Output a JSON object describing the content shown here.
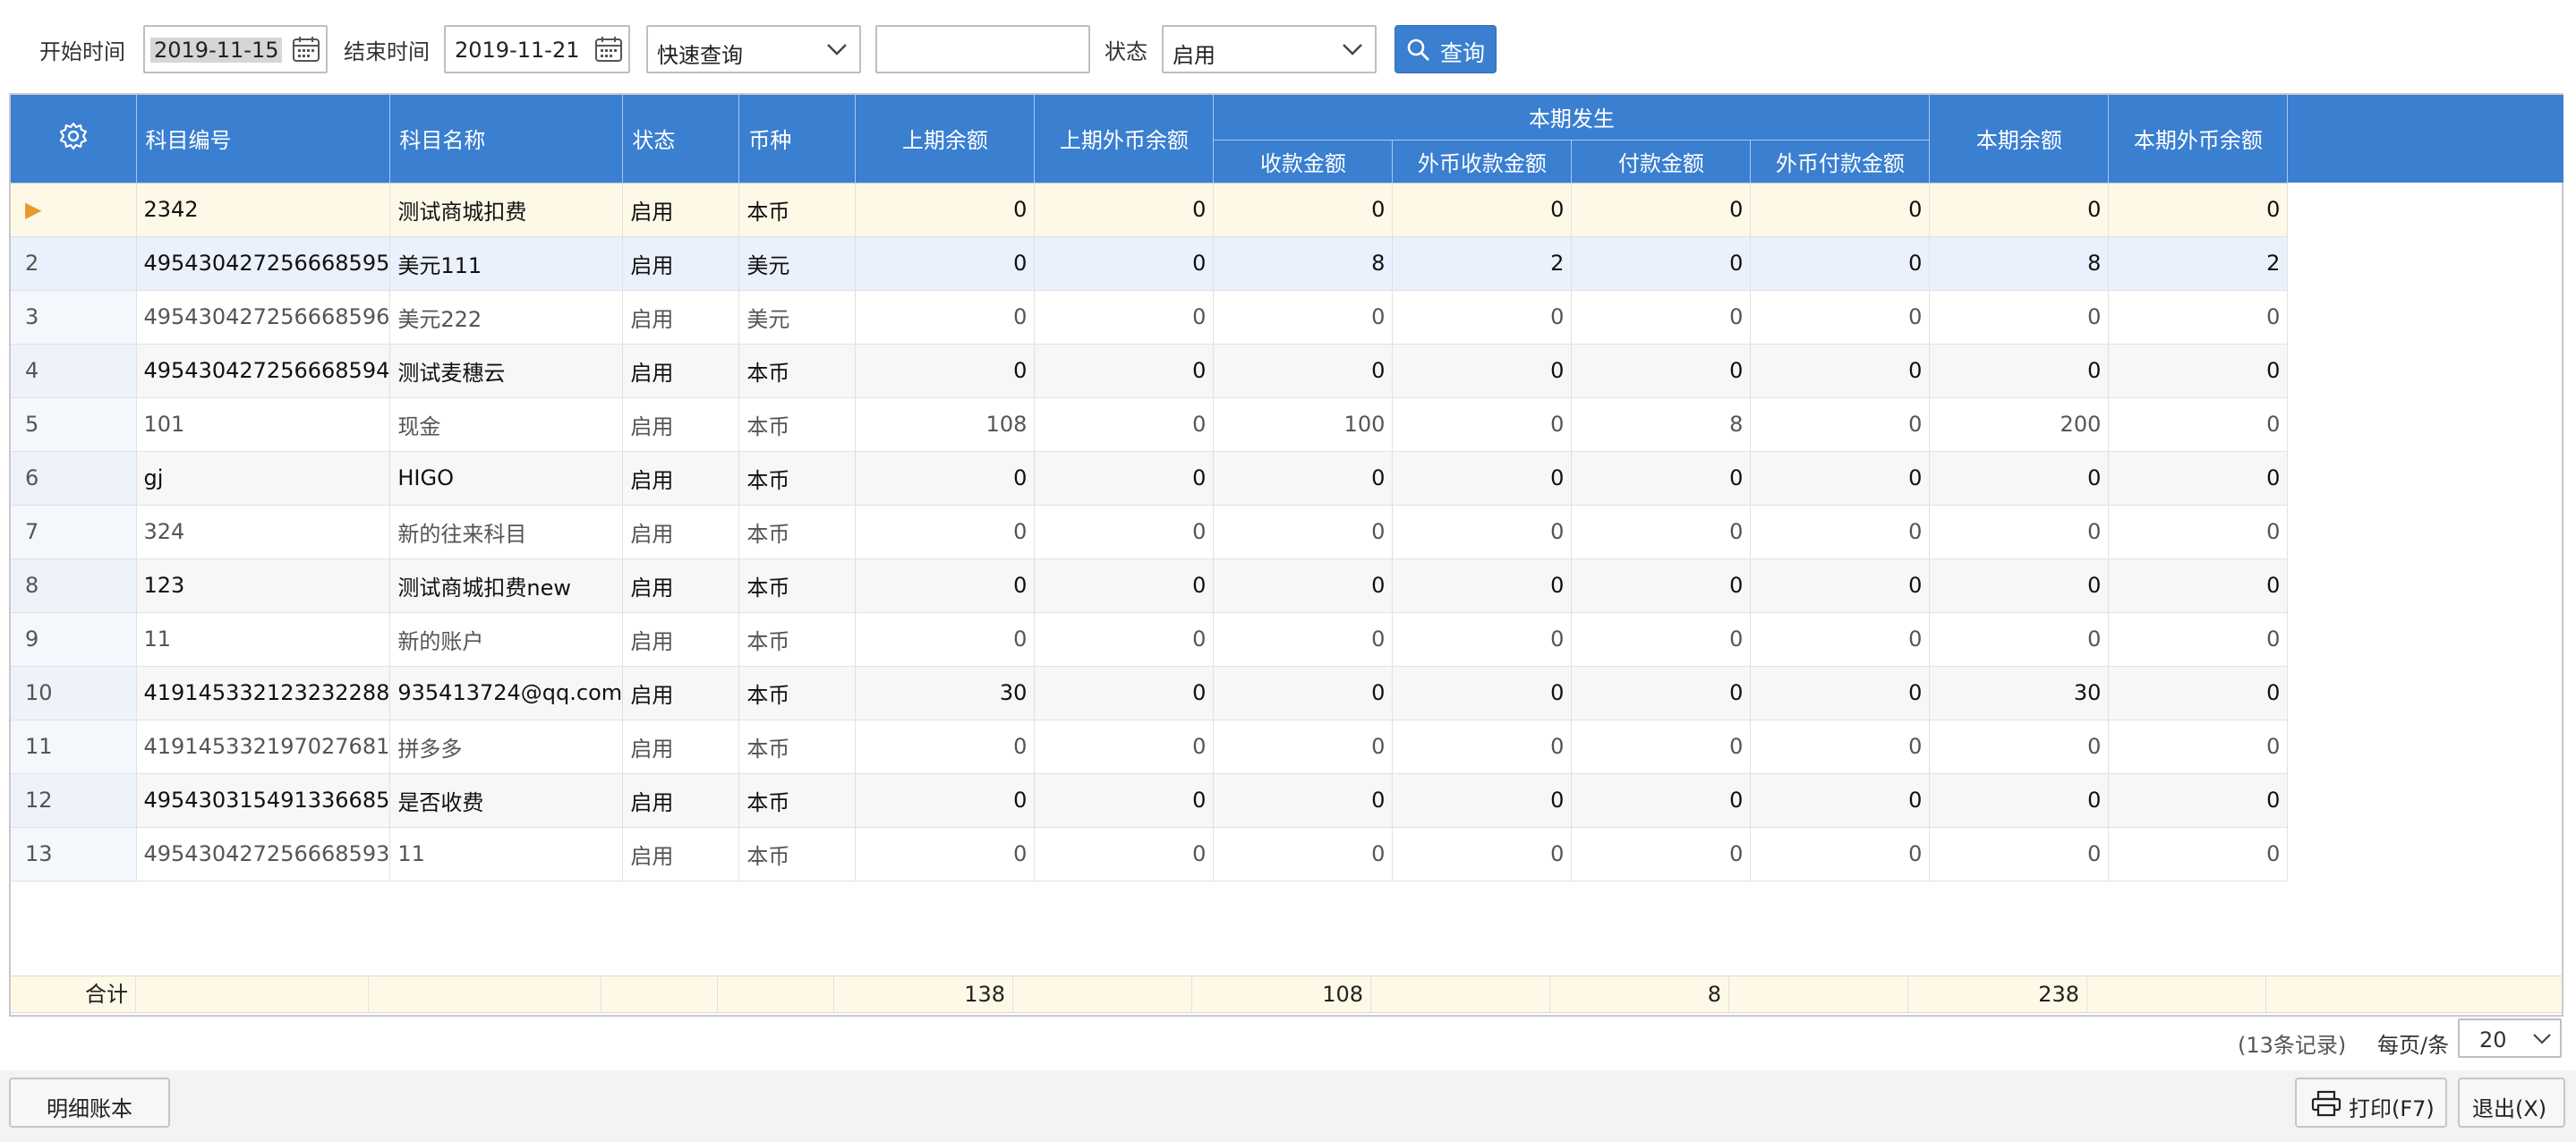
{
  "toolbar": {
    "start_label": "开始时间",
    "start_date": "2019-11-15",
    "end_label": "结束时间",
    "end_date": "2019-11-21",
    "quick_query": "快速查询",
    "search_value": "",
    "status_label": "状态",
    "status_value": "启用",
    "query_button": "查询"
  },
  "colors": {
    "accent": "#3a7fd0",
    "selected_row": "#fdf9e6",
    "marker": "#e89a2c"
  },
  "table": {
    "headers": {
      "code": "科目编号",
      "name": "科目名称",
      "status": "状态",
      "currency": "币种",
      "prev_balance": "上期余额",
      "prev_fx_balance": "上期外币余额",
      "period_group": "本期发生",
      "receipt": "收款金额",
      "fx_receipt": "外币收款金额",
      "payment": "付款金额",
      "fx_payment": "外币付款金额",
      "balance": "本期余额",
      "fx_balance": "本期外币余额"
    },
    "rows": [
      {
        "idx": "▶",
        "code": "2342",
        "name": "测试商城扣费",
        "status": "启用",
        "currency": "本币",
        "v": [
          "0",
          "0",
          "0",
          "0",
          "0",
          "0",
          "0",
          "0"
        ]
      },
      {
        "idx": "2",
        "code": "495430427256668595",
        "name": "美元111",
        "status": "启用",
        "currency": "美元",
        "v": [
          "0",
          "0",
          "8",
          "2",
          "0",
          "0",
          "8",
          "2"
        ]
      },
      {
        "idx": "3",
        "code": "495430427256668596",
        "name": "美元222",
        "status": "启用",
        "currency": "美元",
        "v": [
          "0",
          "0",
          "0",
          "0",
          "0",
          "0",
          "0",
          "0"
        ]
      },
      {
        "idx": "4",
        "code": "495430427256668594",
        "name": "测试麦穗云",
        "status": "启用",
        "currency": "本币",
        "v": [
          "0",
          "0",
          "0",
          "0",
          "0",
          "0",
          "0",
          "0"
        ]
      },
      {
        "idx": "5",
        "code": "101",
        "name": "现金",
        "status": "启用",
        "currency": "本币",
        "v": [
          "108",
          "0",
          "100",
          "0",
          "8",
          "0",
          "200",
          "0"
        ]
      },
      {
        "idx": "6",
        "code": "gj",
        "name": "HIGO",
        "status": "启用",
        "currency": "本币",
        "v": [
          "0",
          "0",
          "0",
          "0",
          "0",
          "0",
          "0",
          "0"
        ]
      },
      {
        "idx": "7",
        "code": "324",
        "name": "新的往来科目",
        "status": "启用",
        "currency": "本币",
        "v": [
          "0",
          "0",
          "0",
          "0",
          "0",
          "0",
          "0",
          "0"
        ]
      },
      {
        "idx": "8",
        "code": "123",
        "name": "测试商城扣费new",
        "status": "启用",
        "currency": "本币",
        "v": [
          "0",
          "0",
          "0",
          "0",
          "0",
          "0",
          "0",
          "0"
        ]
      },
      {
        "idx": "9",
        "code": "11",
        "name": "新的账户",
        "status": "启用",
        "currency": "本币",
        "v": [
          "0",
          "0",
          "0",
          "0",
          "0",
          "0",
          "0",
          "0"
        ]
      },
      {
        "idx": "10",
        "code": "419145332123232288",
        "name": "935413724@qq.com",
        "status": "启用",
        "currency": "本币",
        "v": [
          "30",
          "0",
          "0",
          "0",
          "0",
          "0",
          "30",
          "0"
        ]
      },
      {
        "idx": "11",
        "code": "419145332197027681",
        "name": "拼多多",
        "status": "启用",
        "currency": "本币",
        "v": [
          "0",
          "0",
          "0",
          "0",
          "0",
          "0",
          "0",
          "0"
        ]
      },
      {
        "idx": "12",
        "code": "495430315491336685",
        "name": "是否收费",
        "status": "启用",
        "currency": "本币",
        "v": [
          "0",
          "0",
          "0",
          "0",
          "0",
          "0",
          "0",
          "0"
        ]
      },
      {
        "idx": "13",
        "code": "495430427256668593",
        "name": "11",
        "status": "启用",
        "currency": "本币",
        "v": [
          "0",
          "0",
          "0",
          "0",
          "0",
          "0",
          "0",
          "0"
        ]
      }
    ],
    "totals": {
      "label": "合计",
      "prev_balance": "138",
      "receipt": "108",
      "payment": "8",
      "balance": "238"
    }
  },
  "pager": {
    "records": "(13条记录)",
    "per_page_label": "每页/条",
    "per_page": "20"
  },
  "footer": {
    "detail_ledger": "明细账本",
    "print": "打印(F7)",
    "exit": "退出(X)"
  }
}
